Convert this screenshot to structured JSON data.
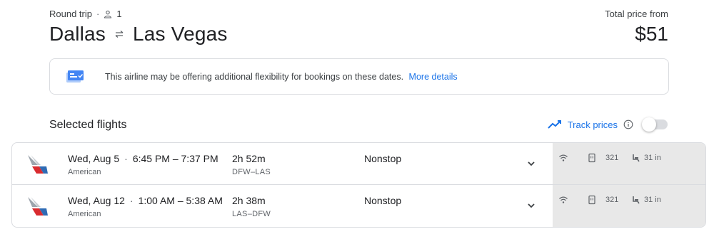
{
  "header": {
    "trip_type": "Round trip",
    "dot": "·",
    "passengers": "1",
    "origin": "Dallas",
    "destination": "Las Vegas",
    "price_label": "Total price from",
    "price": "$51"
  },
  "notice": {
    "text": "This airline may be offering additional flexibility for bookings on these dates.",
    "link": "More details"
  },
  "selected": {
    "title": "Selected flights",
    "track_label": "Track prices",
    "track_enabled": false
  },
  "flights": [
    {
      "date": "Wed, Aug 5",
      "sep": "·",
      "time_range": "6:45 PM – 7:37 PM",
      "airline": "American",
      "duration": "2h 52m",
      "route": "DFW–LAS",
      "stops": "Nonstop",
      "aircraft": "321",
      "legroom": "31 in"
    },
    {
      "date": "Wed, Aug 12",
      "sep": "·",
      "time_range": "1:00 AM – 5:38 AM",
      "airline": "American",
      "duration": "2h 38m",
      "route": "LAS–DFW",
      "stops": "Nonstop",
      "aircraft": "321",
      "legroom": "31 in"
    }
  ],
  "icons": {
    "person": "person-icon",
    "swap": "swap-arrows-icon",
    "notice": "calendar-ticket-icon",
    "track": "trending-line-icon",
    "info": "info-icon",
    "expand": "chevron-down-icon",
    "wifi": "wifi-icon",
    "power": "power-outlet-icon",
    "seat": "seat-icon"
  },
  "colors": {
    "link": "#1a73e8",
    "border": "#dadce0",
    "amenities_bg": "#e8e8e8"
  }
}
